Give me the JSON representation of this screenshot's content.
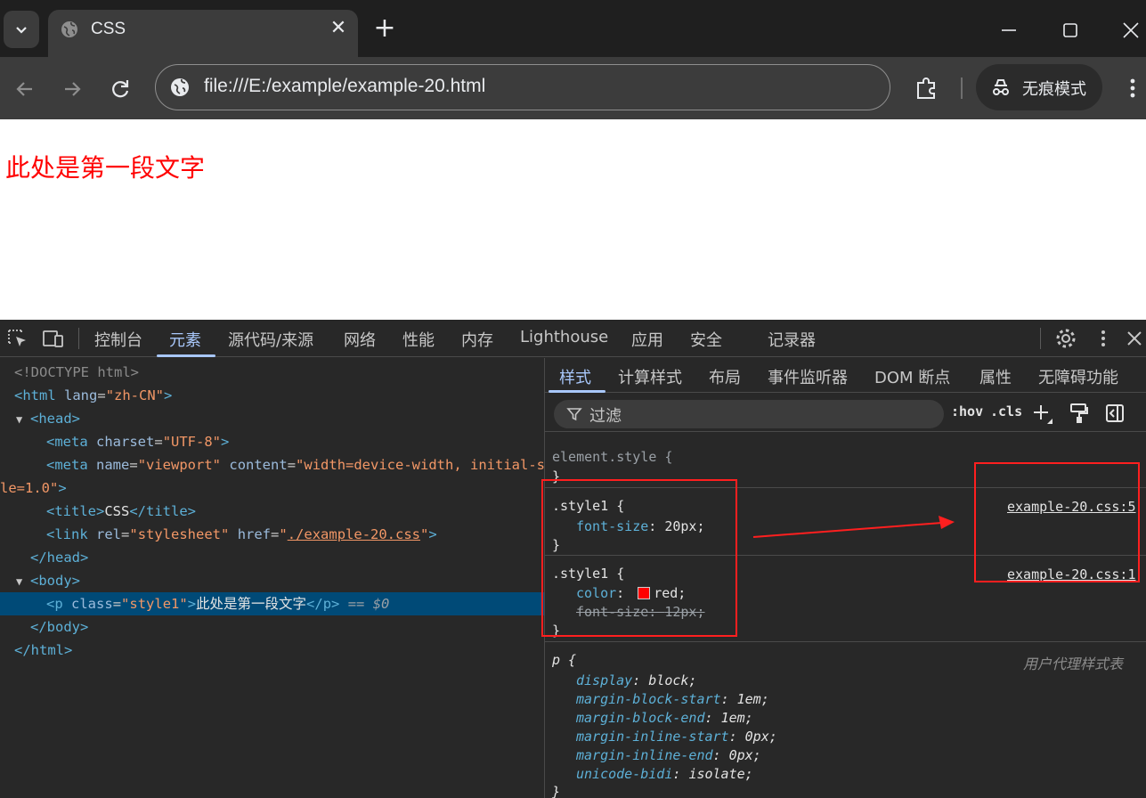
{
  "tab": {
    "title": "CSS",
    "close": "✕"
  },
  "new_tab": "+",
  "toolbar": {
    "url": "file:///E:/example/example-20.html",
    "incognito_label": "无痕模式"
  },
  "page": {
    "paragraph": "此处是第一段文字"
  },
  "devtools": {
    "tabs": [
      "控制台",
      "元素",
      "源代码/来源",
      "网络",
      "性能",
      "内存",
      "Lighthouse",
      "应用",
      "安全",
      "记录器"
    ],
    "active_tab": "元素",
    "dom": {
      "doctype": "<!DOCTYPE html>",
      "html_open_tag": "<html",
      "html_lang_attr": "lang",
      "html_lang_value": "\"zh-CN\"",
      "head_open": "<head>",
      "meta1_tag": "<meta",
      "meta1_attr": "charset",
      "meta1_value": "\"UTF-8\"",
      "meta2_tag": "<meta",
      "meta2_name_attr": "name",
      "meta2_name_value": "\"viewport\"",
      "meta2_content_attr": "content",
      "meta2_content_value_a": "\"width=device-width, initial-sca",
      "meta2_content_value_b": "le=1.0\"",
      "title_open": "<title>",
      "title_text": "CSS",
      "title_close": "</title>",
      "link_tag": "<link",
      "link_rel_attr": "rel",
      "link_rel_value": "\"stylesheet\"",
      "link_href_attr": "href",
      "link_href_value": "./example-20.css",
      "head_close": "</head>",
      "body_open": "<body>",
      "p_open_tag": "<p",
      "p_class_attr": "class",
      "p_class_value": "\"style1\"",
      "p_text": "此处是第一段文字",
      "p_close": "</p>",
      "p_marker": "== $0",
      "body_close": "</body>",
      "html_close": "</html>"
    },
    "styles_tabs": [
      "样式",
      "计算样式",
      "布局",
      "事件监听器",
      "DOM 断点",
      "属性",
      "无障碍功能"
    ],
    "filter_placeholder": "过滤",
    "hov": ":hov",
    "cls": ".cls",
    "rules": {
      "element_style": "element.style {",
      "close_brace": "}",
      "rule1_selector": ".style1 {",
      "rule1_source": "example-20.css:5",
      "rule1_prop": "font-size",
      "rule1_val": "20px;",
      "rule2_selector": ".style1 {",
      "rule2_source": "example-20.css:1",
      "rule2_prop1": "color",
      "rule2_val1": "red;",
      "rule2_prop2": "font-size",
      "rule2_val2": "12px;",
      "ua_selector": "p {",
      "ua_label": "用户代理样式表",
      "ua_props": [
        {
          "prop": "display",
          "val": "block;"
        },
        {
          "prop": "margin-block-start",
          "val": "1em;"
        },
        {
          "prop": "margin-block-end",
          "val": "1em;"
        },
        {
          "prop": "margin-inline-start",
          "val": "0px;"
        },
        {
          "prop": "margin-inline-end",
          "val": "0px;"
        },
        {
          "prop": "unicode-bidi",
          "val": "isolate;"
        }
      ]
    }
  },
  "colors": {
    "page_text": "#ff0000",
    "annotation": "#ff1f1f",
    "devtools_bg": "#282828",
    "accent": "#a8c7fa"
  }
}
